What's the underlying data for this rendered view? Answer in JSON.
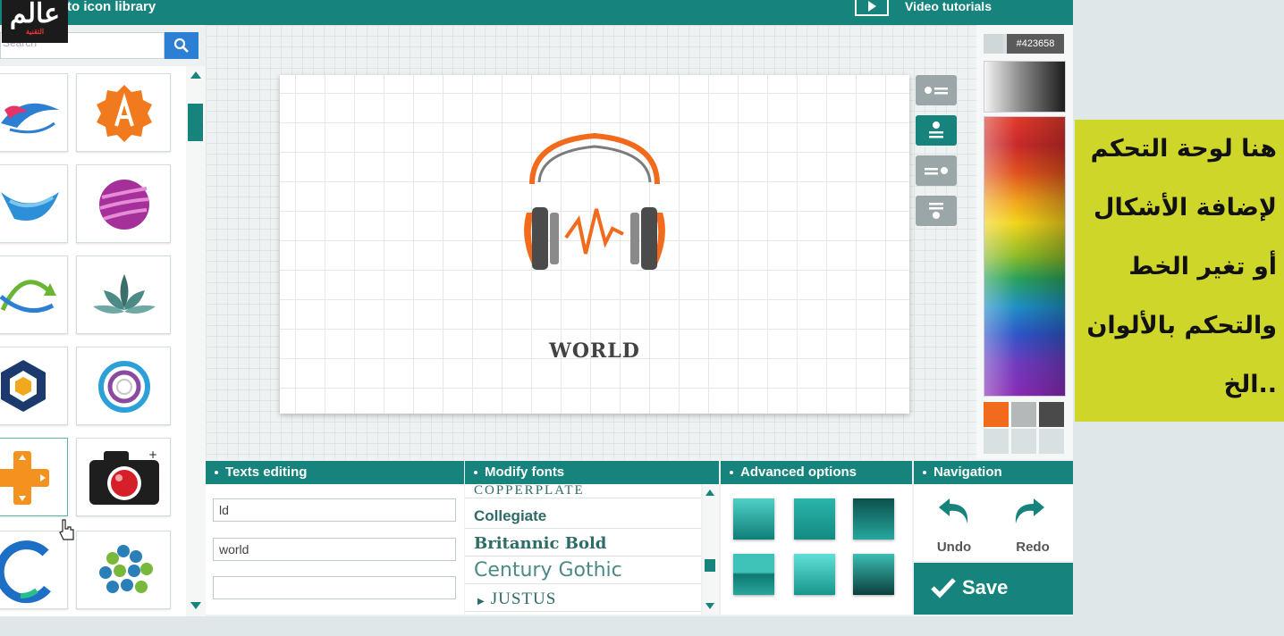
{
  "topbar": {
    "back_label": "to icon library",
    "video_label": "Video tutorials"
  },
  "watermark": {
    "text": "عالم",
    "subtext": "التقنية"
  },
  "search": {
    "placeholder": "Search"
  },
  "icon_library": {
    "icons": [
      "bird-swoosh-icon",
      "orange-badge-icon",
      "blue-wave-icon",
      "purple-sphere-icon",
      "green-arrows-icon",
      "lotus-icon",
      "hexagon-icon",
      "ring-swirl-icon",
      "orange-cross-icon",
      "camera-icon",
      "blue-c-icon",
      "teal-clover-icon"
    ]
  },
  "canvas": {
    "logo_text": "WORLD"
  },
  "color_picker": {
    "hex_value": "#423658",
    "swatches": [
      "#f26b1d",
      "#b5b8b9",
      "#4a4a4a",
      "#d9e0e1",
      "#d9e0e1",
      "#d9e0e1"
    ]
  },
  "annotation": {
    "lines": [
      "هنا لوحة التحكم",
      "لإضافة الأشكال",
      "أو تغير الخط",
      "والتحكم بالألوان",
      "الخ.."
    ]
  },
  "texts_editing": {
    "title": "Texts editing",
    "fields": [
      "ld",
      "world",
      ""
    ]
  },
  "modify_fonts": {
    "title": "Modify fonts",
    "fonts": [
      "COPPERPLATE",
      "Collegiate",
      "Britannic Bold",
      "Century Gothic",
      "JUSTUS"
    ]
  },
  "advanced_options": {
    "title": "Advanced options"
  },
  "navigation": {
    "title": "Navigation",
    "undo_label": "Undo",
    "redo_label": "Redo",
    "save_label": "Save"
  },
  "colors": {
    "accent": "#16847c",
    "annotation_bg": "#cfd62a",
    "logo_orange": "#f26b1d"
  }
}
